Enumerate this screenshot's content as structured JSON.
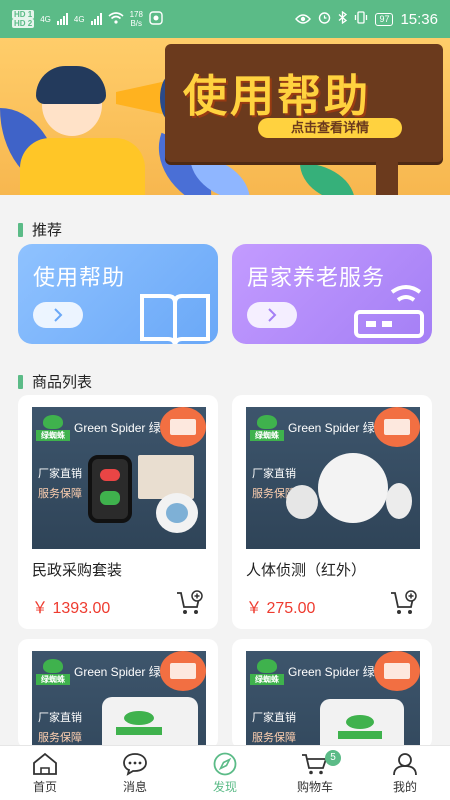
{
  "status_bar": {
    "sim1": "HD 1",
    "sim2": "HD 2",
    "net_type": "4G",
    "net_speed_value": "178",
    "net_speed_unit": "B/s",
    "battery": "97",
    "time": "15:36"
  },
  "banner": {
    "title": "使用帮助",
    "subtitle": "点击查看详情"
  },
  "recommend": {
    "section_title": "推荐",
    "cards": [
      {
        "label": "使用帮助",
        "icon": "book-icon"
      },
      {
        "label": "居家养老服务",
        "icon": "router-icon"
      }
    ]
  },
  "products": {
    "section_title": "商品列表",
    "image_brand": "Green Spider 绿",
    "image_logo_cn": "绿蜘蛛",
    "image_tag1": "厂家直销",
    "image_tag2": "服务保障",
    "items": [
      {
        "name": "民政采购套装",
        "price": "￥ 1393.00"
      },
      {
        "name": "人体侦测（红外）",
        "price": "￥ 275.00"
      },
      {
        "name": "",
        "price": ""
      },
      {
        "name": "",
        "price": ""
      }
    ]
  },
  "bottom_nav": {
    "items": [
      {
        "label": "首页",
        "icon": "home-icon"
      },
      {
        "label": "消息",
        "icon": "message-icon"
      },
      {
        "label": "发现",
        "icon": "compass-icon"
      },
      {
        "label": "购物车",
        "icon": "cart-icon",
        "badge": "5"
      },
      {
        "label": "我的",
        "icon": "user-icon"
      }
    ],
    "active": "发现"
  },
  "colors": {
    "accent": "#5bbb87",
    "price": "#ee3b2f",
    "help_card": "#7db6ff",
    "home_card": "#b28cfa"
  }
}
